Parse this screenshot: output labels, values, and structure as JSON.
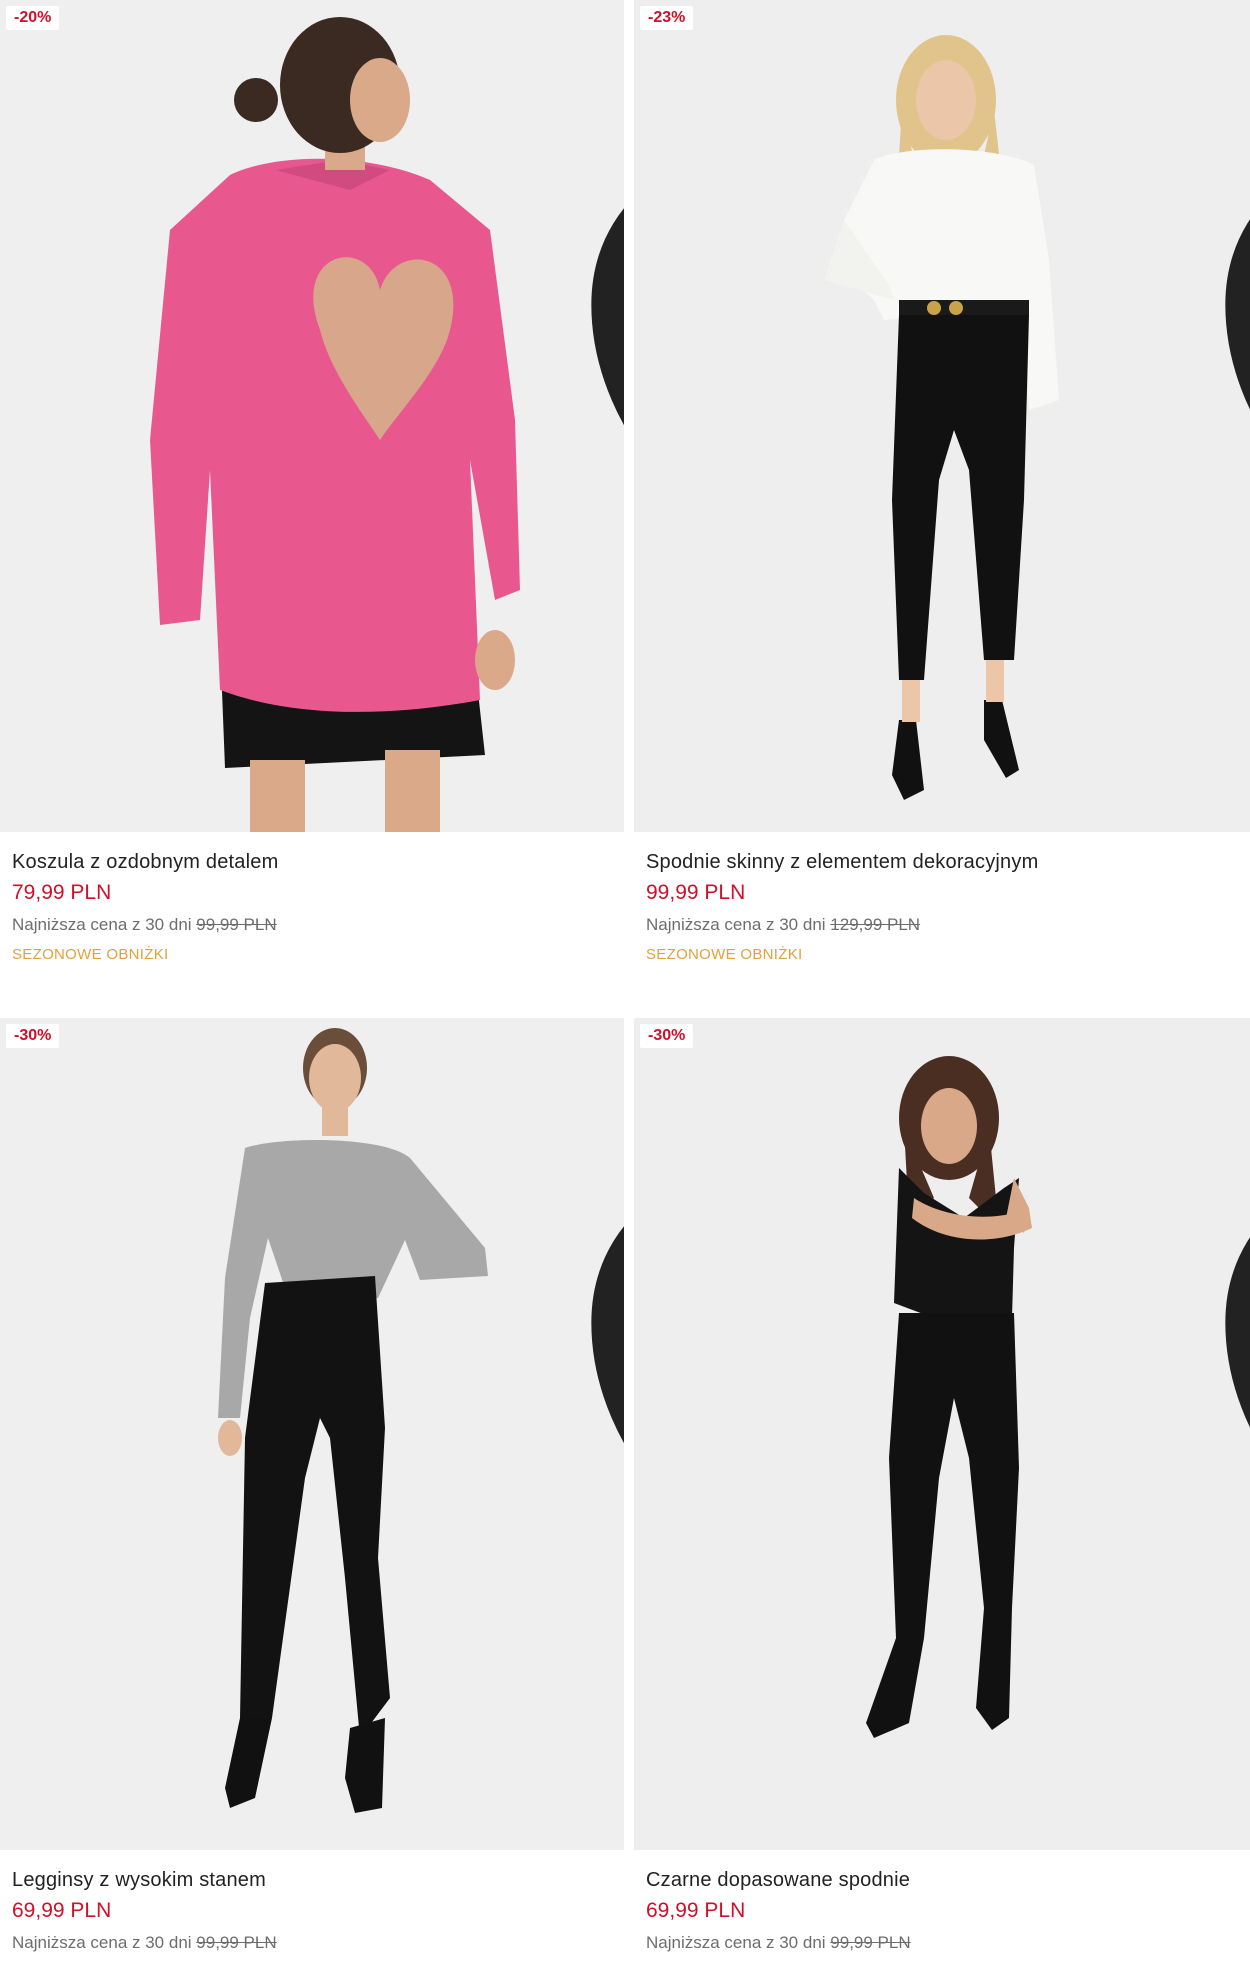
{
  "products": [
    {
      "badge": "-20%",
      "title": "Koszula z ozdobnym detalem",
      "price": "79,99 PLN",
      "lowest_label": "Najniższa cena z 30 dni",
      "lowest_price": "99,99 PLN",
      "tag": "SEZONOWE OBNIŻKI",
      "image_alt": "Model in pink shirt with heart-shaped back cutout and black skirt"
    },
    {
      "badge": "-23%",
      "title": "Spodnie skinny z elementem dekoracyjnym",
      "price": "99,99 PLN",
      "lowest_label": "Najniższa cena z 30 dni",
      "lowest_price": "129,99 PLN",
      "tag": "SEZONOWE OBNIŻKI",
      "image_alt": "Model in white blouse and black skinny trousers with decorative belt"
    },
    {
      "badge": "-30%",
      "title": "Legginsy z wysokim stanem",
      "price": "69,99 PLN",
      "lowest_label": "Najniższa cena z 30 dni",
      "lowest_price": "99,99 PLN",
      "image_alt": "Model in grey knit top and black high-waist leggings"
    },
    {
      "badge": "-30%",
      "title": "Czarne dopasowane spodnie",
      "price": "69,99 PLN",
      "lowest_label": "Najniższa cena z 30 dni",
      "lowest_price": "99,99 PLN",
      "image_alt": "Model in black vest and black fitted trousers"
    }
  ],
  "colors": {
    "sale_red": "#d0102a",
    "tag_orange": "#e2a13a",
    "text_dark": "#222222",
    "text_muted": "#6d6d6d",
    "image_bg": "#eeeeee"
  },
  "icons": {
    "favorite": "heart-outline-icon"
  }
}
